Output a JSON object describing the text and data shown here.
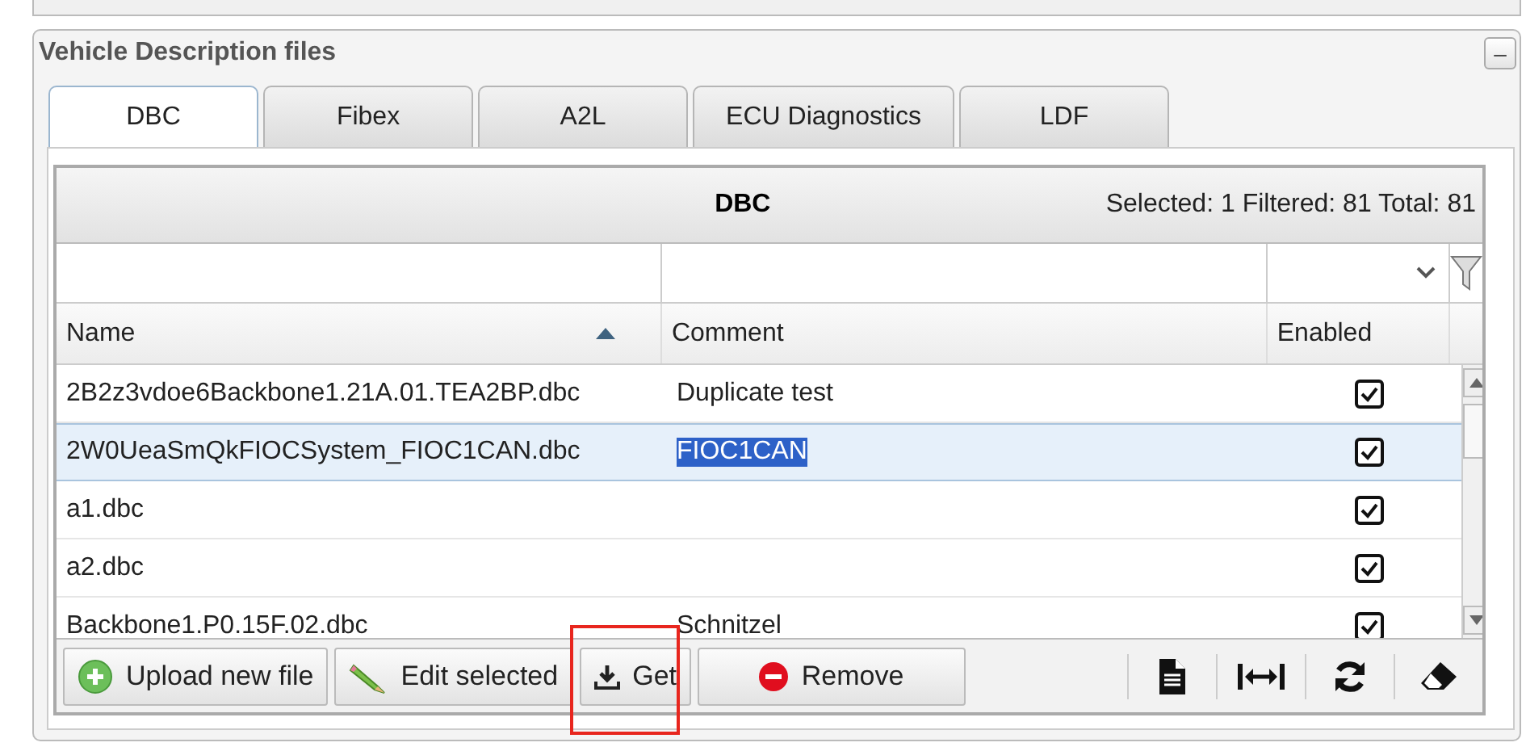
{
  "panel": {
    "title": "Vehicle Description files",
    "collapse_symbol": "–"
  },
  "tabs": [
    {
      "label": "DBC",
      "selected": true
    },
    {
      "label": "Fibex",
      "selected": false
    },
    {
      "label": "A2L",
      "selected": false
    },
    {
      "label": "ECU Diagnostics",
      "selected": false
    },
    {
      "label": "LDF",
      "selected": false
    }
  ],
  "grid": {
    "title": "DBC",
    "summary": "Selected: 1 Filtered: 81 Total: 81",
    "columns": [
      {
        "label": "Name",
        "sorted": true
      },
      {
        "label": "Comment",
        "sorted": false
      },
      {
        "label": "Enabled",
        "sorted": false
      }
    ],
    "rows": [
      {
        "name": "2B2z3vdoe6Backbone1.21A.01.TEA2BP.dbc",
        "comment": "Duplicate test",
        "enabled": true,
        "selected": false
      },
      {
        "name": "2W0UeaSmQkFIOCSystem_FIOC1CAN.dbc",
        "comment": "FIOC1CAN",
        "enabled": true,
        "selected": true
      },
      {
        "name": "a1.dbc",
        "enabled": true,
        "selected": false
      },
      {
        "name": "a2.dbc",
        "enabled": true,
        "selected": false
      },
      {
        "name": "Backbone1.P0.15F.02.dbc",
        "comment": "Schnitzel",
        "enabled": true,
        "selected": false
      }
    ]
  },
  "toolbar": {
    "buttons": [
      {
        "label": "Upload new file",
        "kind": "upload",
        "highlighted": false
      },
      {
        "label": "Edit selected",
        "kind": "edit",
        "highlighted": false
      },
      {
        "label": "Get",
        "kind": "download",
        "highlighted": true
      },
      {
        "label": "Remove",
        "kind": "remove",
        "highlighted": false
      }
    ],
    "icons": [
      {
        "kind": "document"
      },
      {
        "kind": "fit-width"
      },
      {
        "kind": "refresh"
      },
      {
        "kind": "eraser"
      }
    ]
  }
}
